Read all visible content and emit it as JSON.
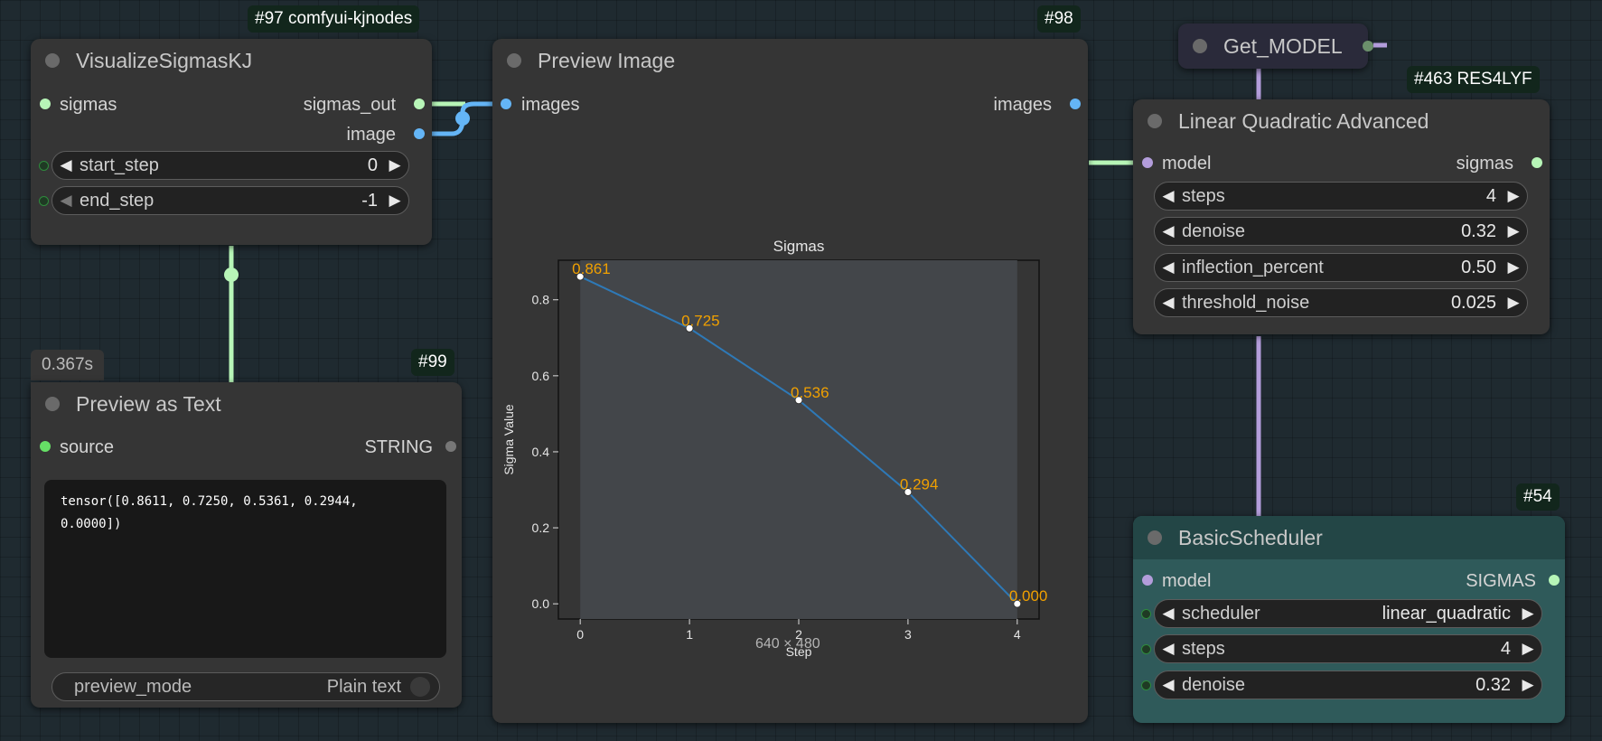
{
  "nodes": {
    "visualize": {
      "badge": "#97 comfyui-kjnodes",
      "title": "VisualizeSigmasKJ",
      "input": "sigmas",
      "outputs": [
        "sigmas_out",
        "image"
      ],
      "widgets": [
        {
          "label": "start_step",
          "value": "0"
        },
        {
          "label": "end_step",
          "value": "-1"
        }
      ]
    },
    "preview_image": {
      "badge": "#98",
      "title": "Preview Image",
      "input": "images",
      "output": "images",
      "dimensions": "640 × 480"
    },
    "get_model": {
      "title": "Get_MODEL"
    },
    "linear_quadratic": {
      "badge": "#463 RES4LYF",
      "title": "Linear Quadratic Advanced",
      "input": "model",
      "output": "sigmas",
      "widgets": [
        {
          "label": "steps",
          "value": "4"
        },
        {
          "label": "denoise",
          "value": "0.32"
        },
        {
          "label": "inflection_percent",
          "value": "0.50"
        },
        {
          "label": "threshold_noise",
          "value": "0.025"
        }
      ]
    },
    "preview_text": {
      "badge": "#99",
      "timing": "0.367s",
      "title": "Preview as Text",
      "input": "source",
      "output": "STRING",
      "text": "tensor([0.8611, 0.7250, 0.5361, 0.2944,\n0.0000])",
      "toggle": {
        "label": "preview_mode",
        "value": "Plain text"
      }
    },
    "basic_scheduler": {
      "badge": "#54",
      "title": "BasicScheduler",
      "input": "model",
      "output": "SIGMAS",
      "widgets": [
        {
          "label": "scheduler",
          "value": "linear_quadratic"
        },
        {
          "label": "steps",
          "value": "4"
        },
        {
          "label": "denoise",
          "value": "0.32"
        }
      ]
    }
  },
  "chart_data": {
    "type": "line",
    "title": "Sigmas",
    "xlabel": "Step",
    "ylabel": "Sigma Value",
    "x": [
      0,
      1,
      2,
      3,
      4
    ],
    "y": [
      0.861,
      0.725,
      0.536,
      0.294,
      0.0
    ],
    "point_labels": [
      "0.861",
      "0.725",
      "0.536",
      "0.294",
      "0.000"
    ],
    "xlim": [
      -0.2,
      4.2
    ],
    "ylim": [
      -0.04,
      0.904
    ],
    "xticks": [
      0,
      1,
      2,
      3,
      4
    ],
    "yticks": [
      0.0,
      0.2,
      0.4,
      0.6,
      0.8
    ],
    "ytick_labels": [
      "0.0",
      "0.2",
      "0.4",
      "0.6",
      "0.8"
    ],
    "line_color": "#2e79b7",
    "label_color": "#f0a000"
  },
  "colors": {
    "sigmas_wire": "#b7f5b7",
    "image_wire": "#64b5f6",
    "model_wire": "#b39ddb",
    "scheduler_body": "#2f5a5a"
  }
}
